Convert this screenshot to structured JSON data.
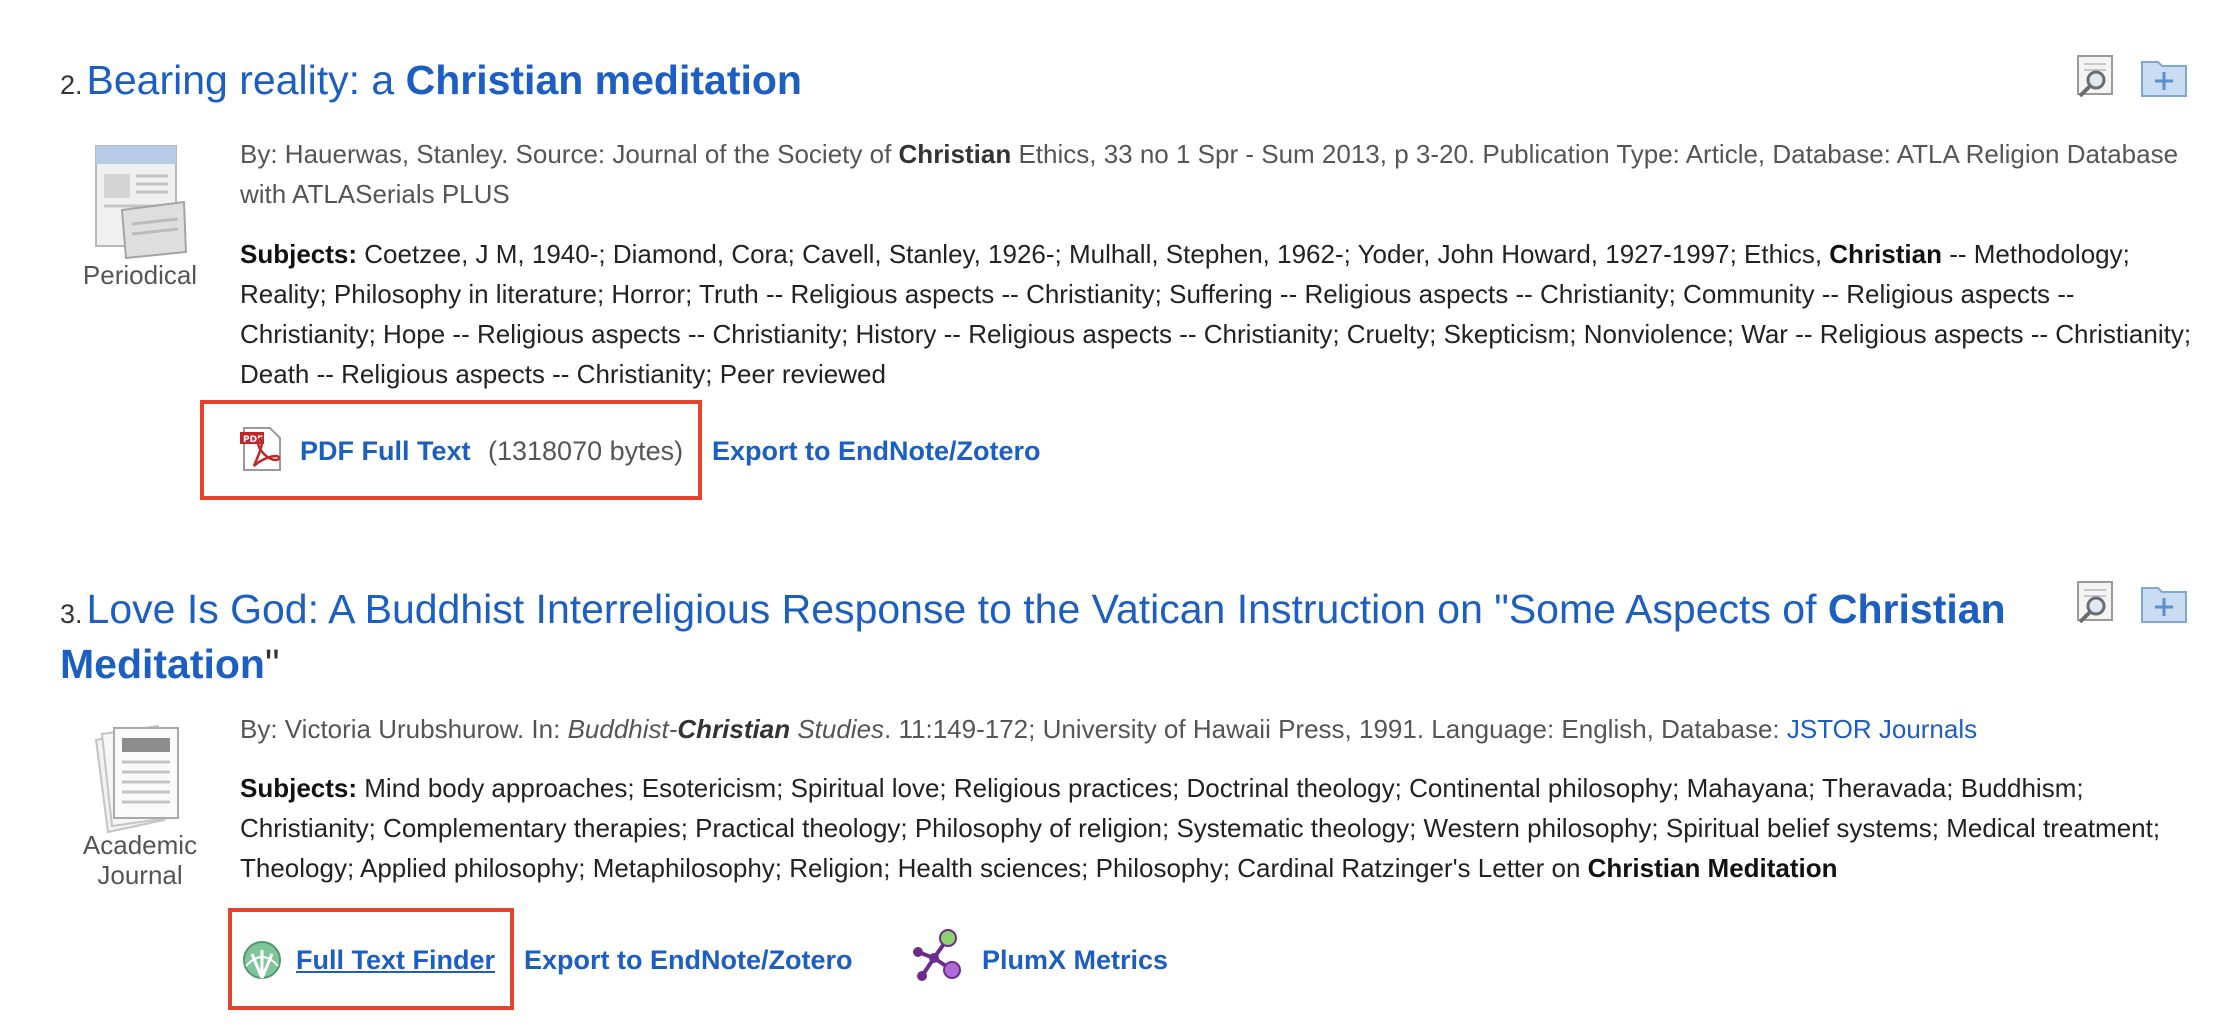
{
  "colors": {
    "link": "#1c5ec1",
    "highlight": "#e5432d",
    "text": "#555555"
  },
  "results": [
    {
      "number": "2.",
      "title_pre": "Bearing reality: a ",
      "title_bold": "Christian meditation",
      "type_icon": "periodical-icon",
      "type_label": "Periodical",
      "meta_pre": "By: Hauerwas, Stanley. Source: Journal of the Society of ",
      "meta_bold": "Christian",
      "meta_post": " Ethics, 33 no 1 Spr - Sum 2013, p 3-20. Publication Type: Article, Database: ATLA Religion Database with ATLASerials PLUS",
      "subjects_label": "Subjects:",
      "subjects_pre": " Coetzee, J M, 1940-; Diamond, Cora; Cavell, Stanley, 1926-; Mulhall, Stephen, 1962-; Yoder, John Howard, 1927-1997; Ethics, ",
      "subjects_bold": "Christian",
      "subjects_post": " -- Methodology; Reality; Philosophy in literature; Horror; Truth -- Religious aspects -- Christianity; Suffering -- Religious aspects -- Christianity; Community -- Religious aspects -- Christianity; Hope -- Religious aspects -- Christianity; History -- Religious aspects -- Christianity; Cruelty; Skepticism; Nonviolence; War -- Religious aspects -- Christianity; Death -- Religious aspects -- Christianity; Peer reviewed",
      "pdf_label": "PDF Full Text",
      "pdf_size": "(1318070 bytes)",
      "export_label": "Export to EndNote/Zotero"
    },
    {
      "number": "3.",
      "title_pre": "Love Is God: A Buddhist Interreligious Response to the Vatican Instruction on \"Some Aspects of ",
      "title_bold": "Christian Meditation",
      "title_post": "\"",
      "type_icon": "academic-journal-icon",
      "type_label_line1": "Academic",
      "type_label_line2": "Journal",
      "meta_pre": "By: Victoria Urubshurow. In: ",
      "meta_italic_pre": "Buddhist-",
      "meta_italic_bold": "Christian",
      "meta_italic_post": " Studies",
      "meta_mid": ". 11:149-172; University of Hawaii Press, 1991. Language: English, Database: ",
      "database_link": "JSTOR Journals",
      "subjects_label": "Subjects:",
      "subjects_pre": " Mind body approaches; Esotericism; Spiritual love; Religious practices; Doctrinal theology; Continental philosophy; Mahayana; Theravada; Buddhism; Christianity; Complementary therapies; Practical theology; Philosophy of religion; Systematic theology; Western philosophy; Spiritual belief systems; Medical treatment; Theology; Applied philosophy; Metaphilosophy; Religion; Health sciences; Philosophy; Cardinal Ratzinger's Letter on ",
      "subjects_bold": "Christian Meditation",
      "fulltext_finder_label": "Full Text Finder",
      "export_label": "Export to EndNote/Zotero",
      "plumx_label": "PlumX Metrics"
    }
  ]
}
